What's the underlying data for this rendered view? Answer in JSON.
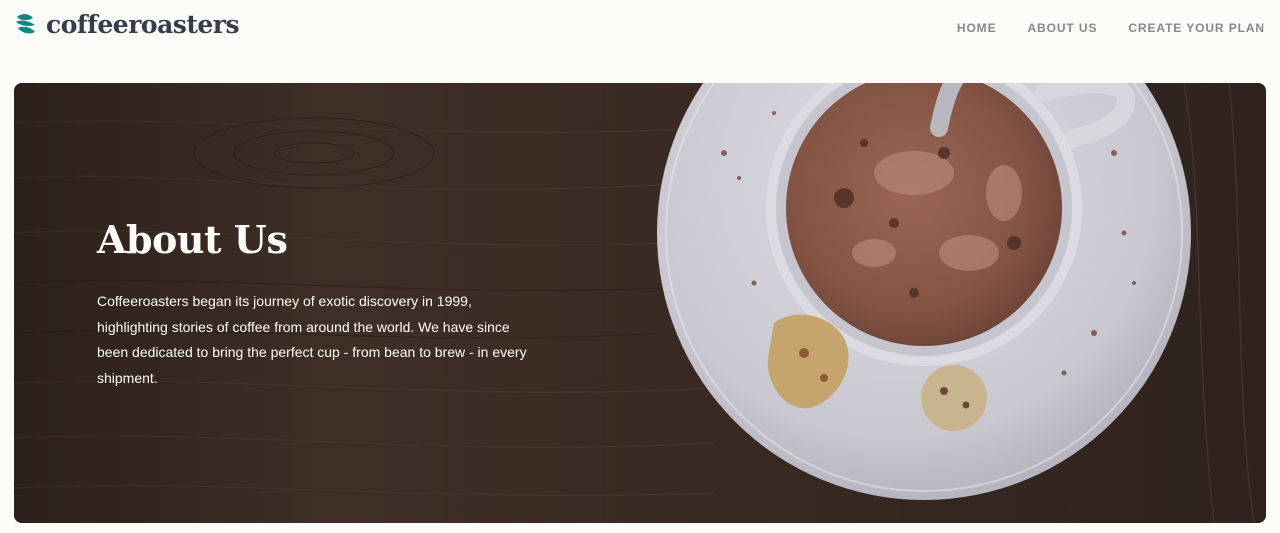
{
  "brand": {
    "name": "coffeeroasters",
    "icon": "coffee-bean-logo-icon",
    "color": "#0e8784"
  },
  "nav": {
    "items": [
      {
        "label": "HOME"
      },
      {
        "label": "ABOUT US"
      },
      {
        "label": "CREATE YOUR PLAN"
      }
    ]
  },
  "hero": {
    "title": "About Us",
    "description": "Coffeeroasters began its journey of exotic discovery in 1999, highlighting stories of coffee from around the world. We have since been dedicated to bring the perfect cup - from bean to brew - in every shipment.",
    "image": "hot-chocolate-cup-on-saucer-over-dark-wood",
    "colors": {
      "wood": "#3b2b24",
      "saucer": "#cfcdd6",
      "drink": "#8a5a4b",
      "text": "#fefcf8"
    }
  }
}
